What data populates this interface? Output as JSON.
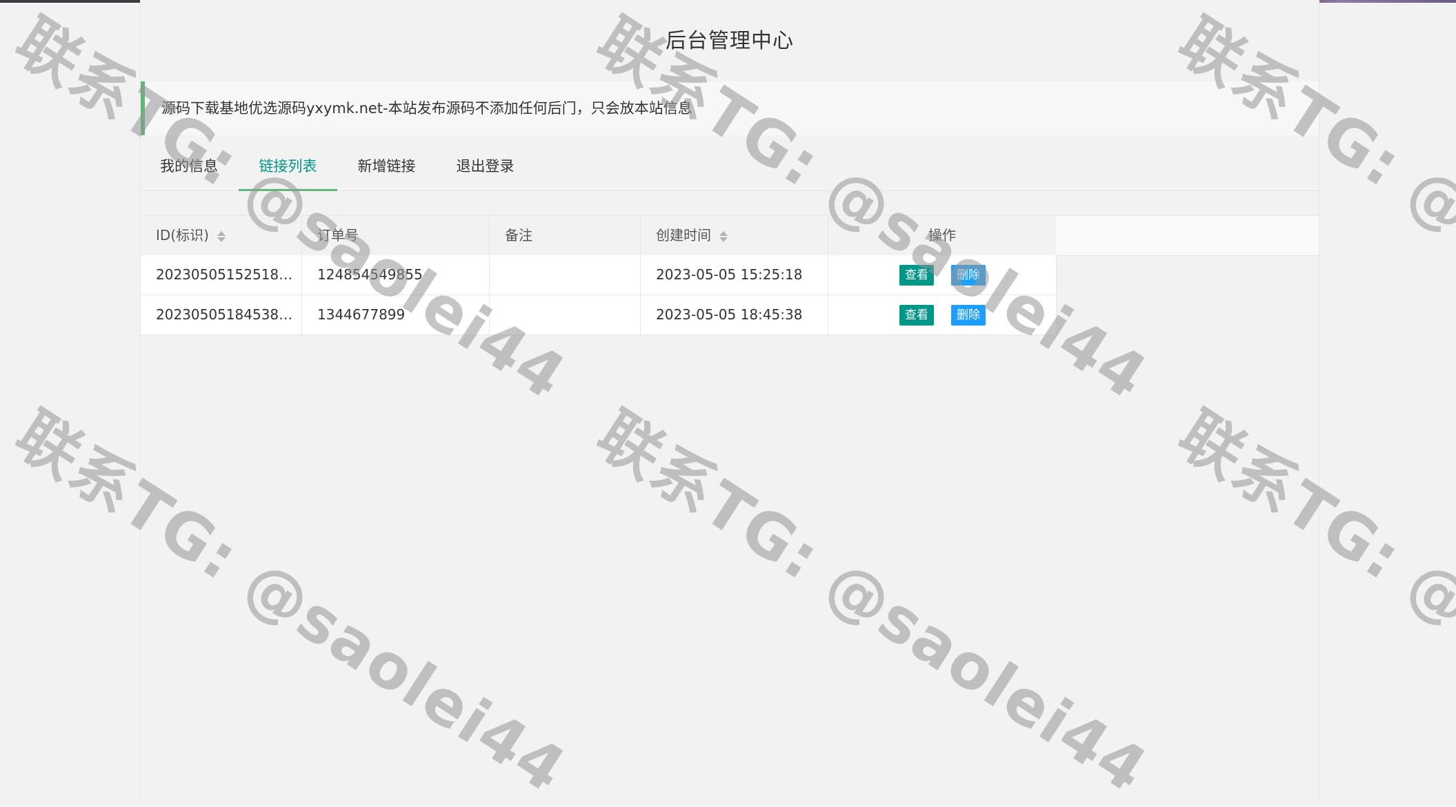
{
  "page": {
    "title": "后台管理中心"
  },
  "notice": {
    "text": "源码下载基地优选源码yxymk.net-本站发布源码不添加任何后门，只会放本站信息"
  },
  "tabs": [
    {
      "label": "我的信息",
      "active": false
    },
    {
      "label": "链接列表",
      "active": true
    },
    {
      "label": "新增链接",
      "active": false
    },
    {
      "label": "退出登录",
      "active": false
    }
  ],
  "table": {
    "headers": [
      "ID(标识)",
      "订单号",
      "备注",
      "创建时间",
      "操作"
    ],
    "rows": [
      {
        "id": "20230505152518…",
        "order": "124854549855",
        "remark": "",
        "created": "2023-05-05 15:25:18",
        "actions": [
          "查看",
          "删除"
        ]
      },
      {
        "id": "20230505184538…",
        "order": "1344677899",
        "remark": "",
        "created": "2023-05-05 18:45:38",
        "actions": [
          "查看",
          "删除"
        ]
      }
    ]
  },
  "watermark": {
    "text": "联系TG: @saolei44"
  },
  "colors": {
    "accent_green": "#009688",
    "accent_blue": "#1e9fff",
    "notice_border": "#5fb878"
  }
}
